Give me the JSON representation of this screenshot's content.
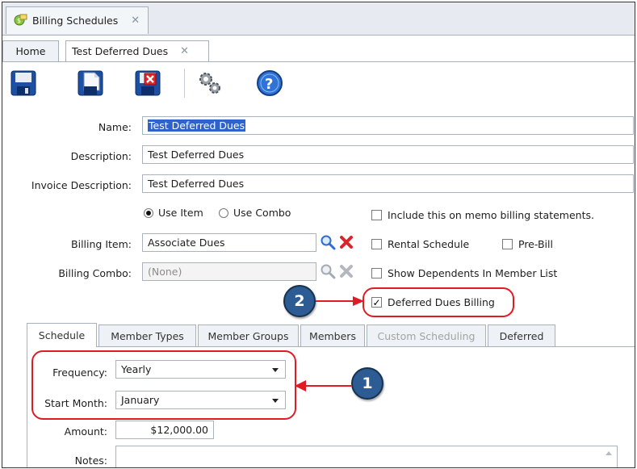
{
  "window": {
    "tab_title": "Billing Schedules",
    "tab_close": "✕"
  },
  "tabs": {
    "home": "Home",
    "active": "Test Deferred Dues",
    "active_close": "✕"
  },
  "toolbar": {
    "icons": [
      "save-icon",
      "save-new-icon",
      "delete-icon",
      "gears-icon",
      "help-icon"
    ]
  },
  "form": {
    "name_label": "Name:",
    "name_value": "Test Deferred Dues",
    "description_label": "Description:",
    "description_value": "Test Deferred Dues",
    "invoice_description_label": "Invoice Description:",
    "invoice_description_value": "Test Deferred Dues",
    "use_item_label": "Use Item",
    "use_combo_label": "Use Combo",
    "use_item_selected": true,
    "billing_item_label": "Billing Item:",
    "billing_item_value": "Associate Dues",
    "billing_combo_label": "Billing Combo:",
    "billing_combo_value": "(None)",
    "checkboxes": {
      "memo_label": "Include this on memo billing statements.",
      "memo_checked": false,
      "rental_label": "Rental Schedule",
      "rental_checked": false,
      "prebill_label": "Pre-Bill",
      "prebill_checked": false,
      "dependents_label": "Show Dependents In Member List",
      "dependents_checked": false,
      "deferred_label": "Deferred Dues Billing",
      "deferred_checked": true
    }
  },
  "lower_tabs": [
    "Schedule",
    "Member Types",
    "Member Groups",
    "Members",
    "Custom Scheduling",
    "Deferred"
  ],
  "schedule": {
    "frequency_label": "Frequency:",
    "frequency_value": "Yearly",
    "start_month_label": "Start Month:",
    "start_month_value": "January",
    "amount_label": "Amount:",
    "amount_value": "$12,000.00",
    "notes_label": "Notes:"
  },
  "annotations": {
    "badge_1": "1",
    "badge_2": "2"
  },
  "colors": {
    "callout_red": "#e01b24",
    "badge_blue": "#2d5b93",
    "selection_blue": "#2f63c9"
  }
}
